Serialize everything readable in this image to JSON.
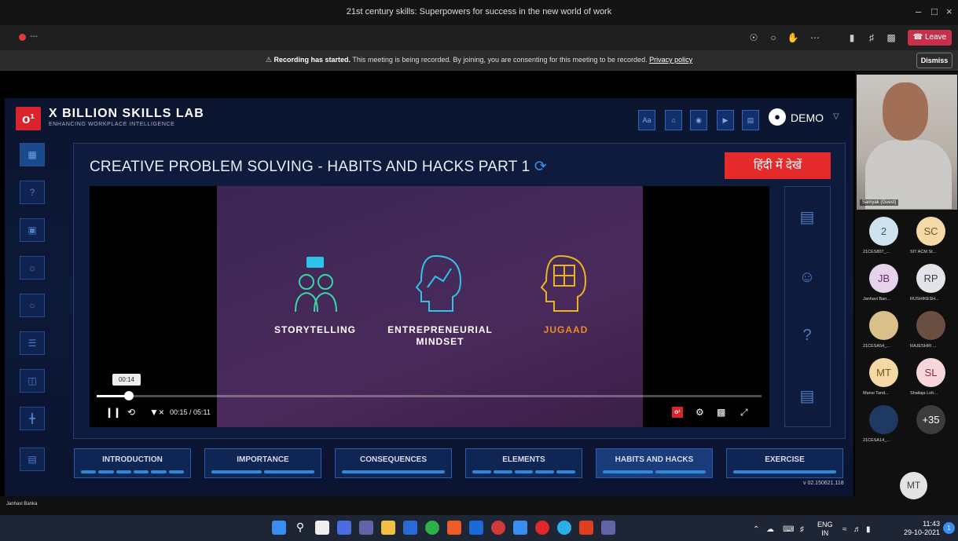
{
  "window": {
    "title": "21st century skills: Superpowers for success in the new world of work"
  },
  "meeting": {
    "recording_indicator": "---",
    "leave_label": "Leave"
  },
  "banner": {
    "bold": "Recording has started.",
    "text": "This meeting is being recorded. By joining, you are consenting for this meeting to be recorded.",
    "link": "Privacy policy",
    "dismiss": "Dismiss"
  },
  "app": {
    "brand": "X BILLION SKILLS LAB",
    "tagline": "ENHANCING WORKPLACE INTELLIGENCE",
    "toolbar": [
      "Aa"
    ],
    "user": "DEMO",
    "lesson_title": "CREATIVE PROBLEM SOLVING - HABITS AND HACKS PART 1",
    "hindi_button": "हिंदी में देखें",
    "topics": [
      {
        "label": "STORYTELLING"
      },
      {
        "label": "ENTREPRENEURIAL MINDSET"
      },
      {
        "label": "JUGAAD"
      }
    ],
    "video": {
      "tooltip": "00:14",
      "current": "00:15",
      "duration": "05:11",
      "time_display": "00:15 / 05:11",
      "progress": 0.045
    },
    "tabs": [
      {
        "label": "INTRODUCTION",
        "bars": 6
      },
      {
        "label": "IMPORTANCE",
        "bars": 2
      },
      {
        "label": "CONSEQUENCES",
        "bars": 1
      },
      {
        "label": "ELEMENTS",
        "bars": 5
      },
      {
        "label": "HABITS AND HACKS",
        "bars": 2,
        "active": true
      },
      {
        "label": "EXERCISE",
        "bars": 1
      }
    ],
    "version": "v 02.150621.118"
  },
  "participants": {
    "speaker": "Samyak (Guest)",
    "tiles": [
      {
        "initials": "2",
        "name": "21CES807_...",
        "color": "#cfe3ef",
        "text": "#2a5a80"
      },
      {
        "initials": "SC",
        "name": "SIT ACM St...",
        "color": "#f4d9a6",
        "text": "#7a5514"
      },
      {
        "initials": "JB",
        "name": "Janhavi Ban...",
        "color": "#e6d2ea",
        "text": "#5b2f6a"
      },
      {
        "initials": "RP",
        "name": "RUSHIKESH...",
        "color": "#e3e3ea",
        "text": "#3a3a55"
      },
      {
        "initials": "",
        "name": "21CESA54_...",
        "color": "#d9c08a",
        "text": "#333"
      },
      {
        "initials": "",
        "name": "RAJESHRI ...",
        "color": "#6a4e42",
        "text": "#fff"
      },
      {
        "initials": "MT",
        "name": "Mansi Tand...",
        "color": "#f4d9a6",
        "text": "#7a5514"
      },
      {
        "initials": "SL",
        "name": "Shailaja Loh...",
        "color": "#f6d6da",
        "text": "#8a2c3a"
      },
      {
        "initials": "",
        "name": "21CESA14_...",
        "color": "#1f3a62",
        "text": "#fff"
      },
      {
        "initials": "+35",
        "name": "",
        "color": "#3c3c3c",
        "text": "#fff"
      }
    ],
    "bottom_name": "Janhavi Banka",
    "self_initials": "MT"
  },
  "taskbar": {
    "lang": "ENG",
    "region": "IN",
    "time": "11:43",
    "date": "29-10-2021",
    "notif": "1"
  }
}
